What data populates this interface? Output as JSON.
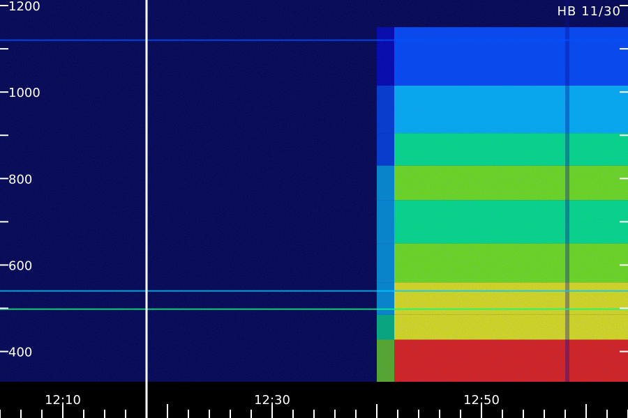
{
  "chart_data": {
    "type": "heatmap",
    "title": "",
    "xlabel": "",
    "ylabel": "",
    "annotation": "HB 11/30",
    "x_ticks": [
      "12:10",
      "12:30",
      "12:50"
    ],
    "y_ticks": [
      400,
      600,
      800,
      1000,
      1200
    ],
    "ylim": [
      330,
      1200
    ],
    "xlim_minutes": [
      0,
      60
    ],
    "separator_time": "12:18",
    "colormap": [
      "#000050",
      "#0000c8",
      "#0050ff",
      "#00c8ff",
      "#00ff80",
      "#80ff00",
      "#ffff00",
      "#ff8000",
      "#ff2000"
    ],
    "bands": [
      {
        "y": 405,
        "level": 0.95
      },
      {
        "y": 450,
        "level": 0.8
      },
      {
        "y": 520,
        "level": 0.7
      },
      {
        "y": 600,
        "level": 0.62
      },
      {
        "y": 700,
        "level": 0.55
      },
      {
        "y": 800,
        "level": 0.6
      },
      {
        "y": 860,
        "level": 0.5
      },
      {
        "y": 950,
        "level": 0.32
      },
      {
        "y": 1080,
        "level": 0.25
      }
    ],
    "onset_time": "12:41",
    "lines": [
      {
        "y": 498,
        "level": 0.55
      },
      {
        "y": 540,
        "level": 0.4
      },
      {
        "y": 1120,
        "level": 0.3
      }
    ]
  }
}
